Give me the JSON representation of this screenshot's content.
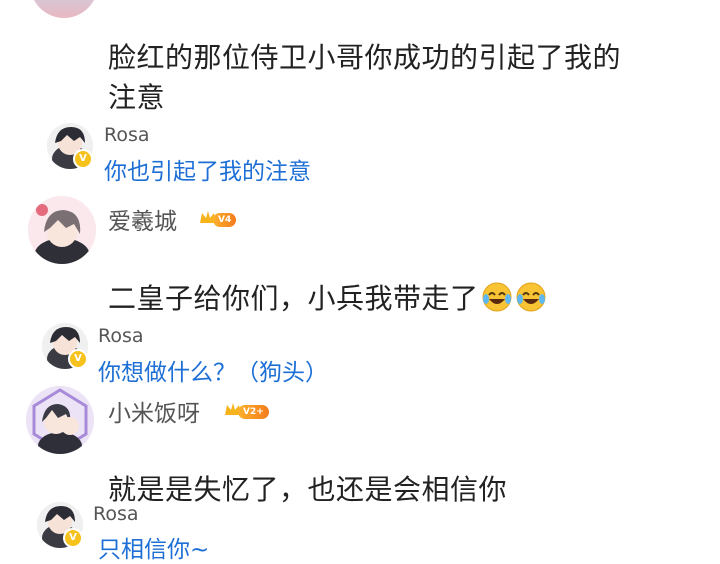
{
  "comments": [
    {
      "text_line1": "脸红的那位侍卫小哥你成功的引起了我的",
      "text_line2": "注意",
      "reply": {
        "name": "Rosa",
        "text": "你也引起了我的注意"
      }
    },
    {
      "user": {
        "name": "爱羲城",
        "level": "V4"
      },
      "text": "二皇子给你们，小兵我带走了",
      "emojis": [
        "laugh-cry-emoji",
        "laugh-cry-emoji"
      ],
      "reply": {
        "name": "Rosa",
        "text": "你想做什么？（狗头）"
      }
    },
    {
      "user": {
        "name": "小米饭呀",
        "level": "V2+"
      },
      "text": "就是是失忆了，也还是会相信你",
      "reply": {
        "name": "Rosa",
        "text": "只相信你~"
      }
    }
  ],
  "colors": {
    "reply_text": "#1d6fd6",
    "body_text": "#222222",
    "badge": "#f7c21c"
  }
}
